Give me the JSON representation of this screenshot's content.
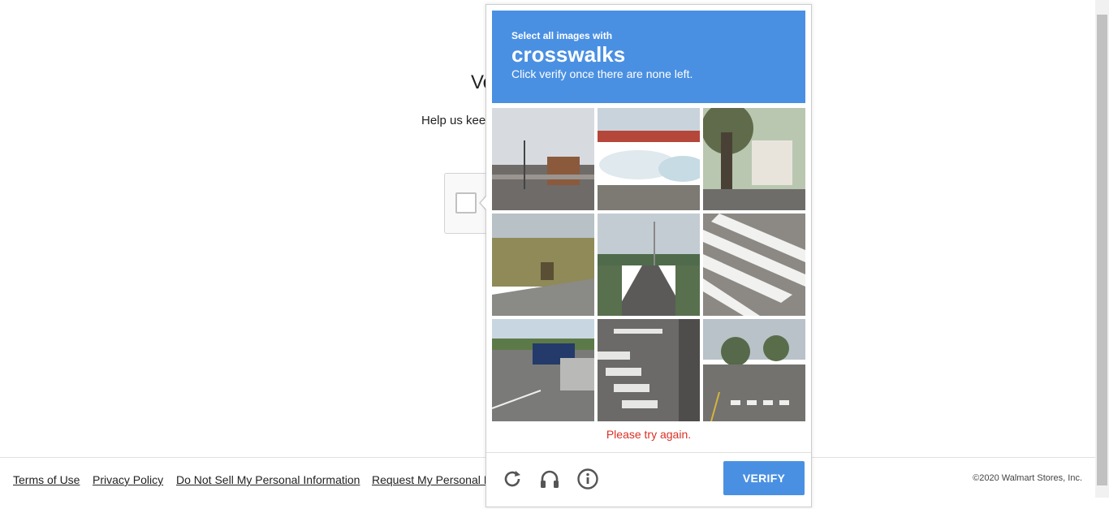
{
  "page": {
    "heading": "Ve",
    "subtext": "Help us kee"
  },
  "footer": {
    "links": [
      "Terms of Use",
      "Privacy Policy",
      "Do Not Sell My Personal Information",
      "Request My Personal In"
    ],
    "copyright": "©2020 Walmart Stores, Inc."
  },
  "captcha": {
    "instruction_small": "Select all images with",
    "keyword": "crosswalks",
    "instruction_hint": "Click verify once there are none left.",
    "tiles": [
      "street-scene",
      "boats-on-trailers",
      "tree-and-house",
      "grass-field-vehicle",
      "overpass-road",
      "crosswalk-stripes",
      "road-with-trucks",
      "crosswalk-intersection",
      "street-with-crosswalk"
    ],
    "error": "Please try again.",
    "verify_label": "VERIFY",
    "icons": [
      "reload-icon",
      "audio-icon",
      "info-icon"
    ],
    "colors": {
      "accent": "#4a90e2",
      "error": "#d93025"
    }
  }
}
